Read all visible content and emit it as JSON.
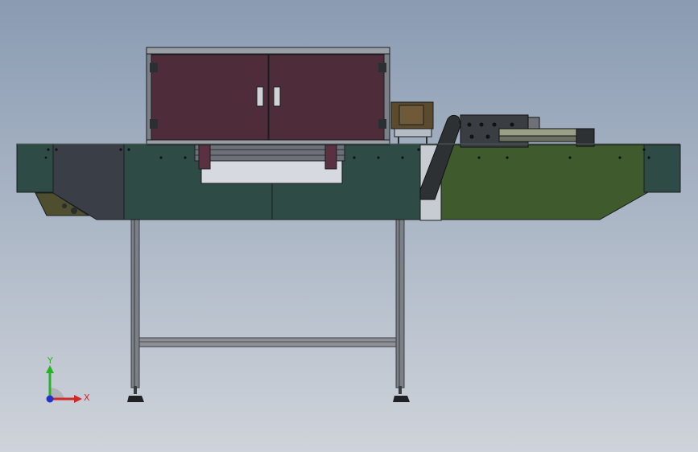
{
  "viewport": {
    "colors": {
      "bg_top": "#8a9bb2",
      "bg_bottom": "#cfd3da",
      "frame_dark_green": "#2f4b45",
      "frame_light_green": "#3f5a2c",
      "dark_gray_panel": "#3a3e47",
      "cabinet_maroon": "#4e2c39",
      "leg_gray": "#7b7f86",
      "steel_dark": "#2b2e32"
    },
    "triad": {
      "y_label": "Y",
      "x_label": "X",
      "y_color": "#27b327",
      "x_color": "#d42727",
      "z_color": "#2233cc",
      "icon": "coordinate-triad-icon"
    }
  }
}
